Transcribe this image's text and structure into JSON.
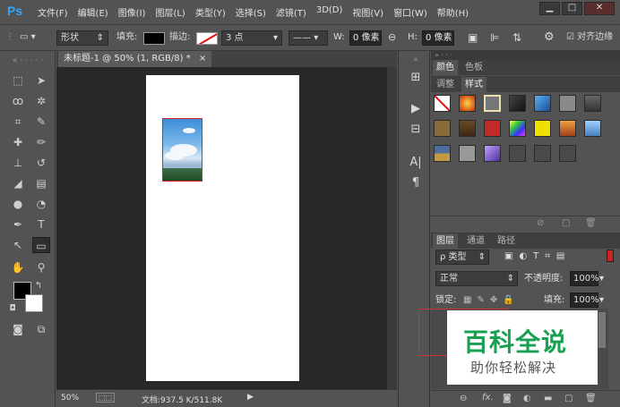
{
  "app": {
    "logo": "Ps",
    "accent": "#31a8ff"
  },
  "menu": [
    "文件(F)",
    "编辑(E)",
    "图像(I)",
    "图层(L)",
    "类型(Y)",
    "选择(S)",
    "滤镜(T)",
    "3D(D)",
    "视图(V)",
    "窗口(W)",
    "帮助(H)"
  ],
  "window_controls": {
    "minimize": "▁",
    "maximize": "□",
    "close": "✕"
  },
  "options": {
    "shape_mode": "形状",
    "fill_label": "填充:",
    "stroke_label": "描边:",
    "stroke_width": "3 点",
    "w_label": "W:",
    "w_value": "0 像素",
    "h_label": "H:",
    "h_value": "0 像素",
    "align_edges": "对齐边缘"
  },
  "document": {
    "tab_title": "未标题-1 @ 50% (1, RGB/8) *",
    "close": "×",
    "zoom": "50%",
    "doc_info": "文档:937.5 K/511.8K"
  },
  "panels": {
    "top_tabs": [
      "颜色",
      "色板"
    ],
    "mid_tabs": [
      "调整",
      "样式"
    ],
    "layer_tabs": [
      "图层",
      "通道",
      "路径"
    ],
    "filter_kind": "ρ 类型",
    "blend_mode": "正常",
    "opacity_label": "不透明度:",
    "opacity_value": "100%",
    "lock_label": "锁定:",
    "fill_label": "填充:",
    "fill_value": "100%"
  },
  "watermark": {
    "title": "百科全说",
    "subtitle": "助你轻松解决",
    "color": "#1aa053"
  }
}
